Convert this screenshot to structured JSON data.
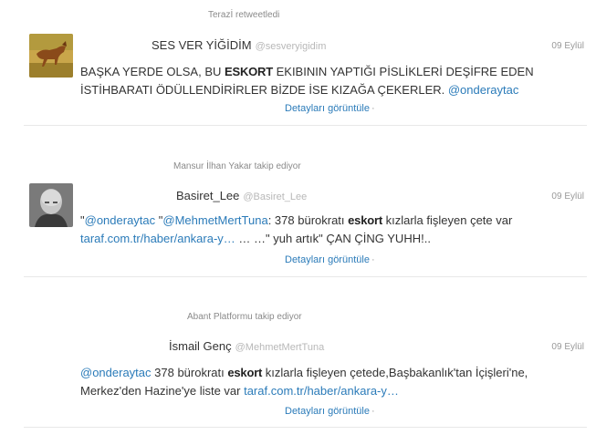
{
  "tweets": [
    {
      "context": "Terazİ retweetledi",
      "name": "SES VER YİĞİDİM",
      "screen_name": "@sesveryigidim",
      "time": "09 Eylül",
      "line1_a": "BAŞKA YERDE OLSA, BU ",
      "line1_bold": "ESKORT",
      "line1_b": " EKIBININ YAPTIĞI PİSLİKLERİ DEŞİFRE EDEN",
      "line2_a": "İSTİHBARATI ÖDÜLLENDİRİRLER BİZDE İSE KIZAĞA ÇEKERLER. ",
      "line2_mention": "@onderaytac",
      "details": "Detayları görüntüle",
      "dot": "·"
    },
    {
      "context": "Mansur İlhan Yakar takip ediyor",
      "name": "Basiret_Lee",
      "screen_name": "@Basiret_Lee",
      "time": "09 Eylül",
      "line1_q1": "\"",
      "line1_mention1": "@onderaytac",
      "line1_q2": " \"",
      "line1_mention2": "@MehmetMertTuna",
      "line1_a": ": 378 bürokratı ",
      "line1_bold": "eskort",
      "line1_b": " kızlarla fişleyen çete var",
      "line2_link": "taraf.com.tr/haber/ankara-y…",
      "line2_rest": " … …\" yuh artık\" ÇAN ÇİNG YUHH!..",
      "details": "Detayları görüntüle",
      "dot": "·"
    },
    {
      "context": "Abant Platformu takip ediyor",
      "name": "İsmail Genç",
      "screen_name": "@MehmetMertTuna",
      "time": "09 Eylül",
      "line1_mention": "@onderaytac",
      "line1_a": " 378 bürokratı ",
      "line1_bold": "eskort",
      "line1_b": " kızlarla fişleyen çetede,Başbakanlık'tan İçişleri'ne,",
      "line2_a": "Merkez'den Hazine'ye liste var ",
      "line2_link": "taraf.com.tr/haber/ankara-y…",
      "details": "Detayları görüntüle",
      "dot": "·"
    }
  ],
  "colors": {
    "link": "#2b7bb9",
    "muted": "#999999",
    "divider": "#e8e8e8"
  },
  "icons": [
    "horse-avatar",
    "monk-avatar"
  ]
}
